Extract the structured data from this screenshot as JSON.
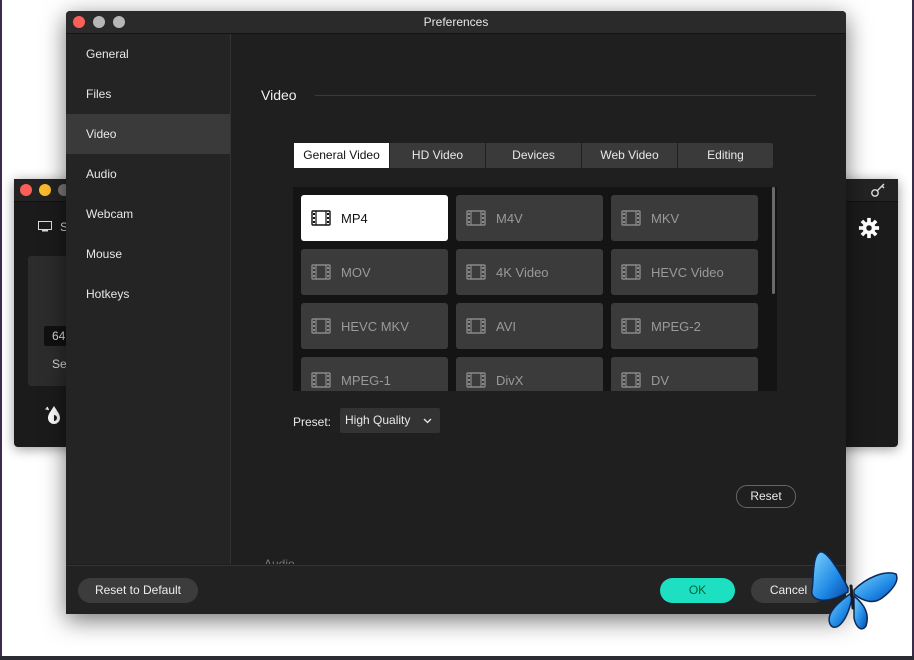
{
  "background_window": {
    "label_fragment": "S",
    "chip1": "64",
    "chip2": "Se"
  },
  "window": {
    "title": "Preferences"
  },
  "sidebar": {
    "items": [
      {
        "label": "General"
      },
      {
        "label": "Files"
      },
      {
        "label": "Video",
        "active": true
      },
      {
        "label": "Audio"
      },
      {
        "label": "Webcam"
      },
      {
        "label": "Mouse"
      },
      {
        "label": "Hotkeys"
      }
    ]
  },
  "section": {
    "title": "Video",
    "next_section_partial": "Audio"
  },
  "tabs": [
    {
      "label": "General Video",
      "active": true
    },
    {
      "label": "HD Video"
    },
    {
      "label": "Devices"
    },
    {
      "label": "Web Video"
    },
    {
      "label": "Editing"
    }
  ],
  "formats": [
    {
      "label": "MP4",
      "selected": true
    },
    {
      "label": "M4V"
    },
    {
      "label": "MKV"
    },
    {
      "label": "MOV"
    },
    {
      "label": "4K Video"
    },
    {
      "label": "HEVC Video"
    },
    {
      "label": "HEVC MKV"
    },
    {
      "label": "AVI"
    },
    {
      "label": "MPEG-2"
    },
    {
      "label": "MPEG-1"
    },
    {
      "label": "DivX"
    },
    {
      "label": "DV"
    }
  ],
  "preset": {
    "label": "Preset:",
    "value": "High Quality"
  },
  "buttons": {
    "reset": "Reset",
    "reset_default": "Reset to Default",
    "ok": "OK",
    "cancel": "Cancel"
  },
  "colors": {
    "accent_ok": "#1de0c2",
    "background": "#1f1f1f",
    "sidebar_active": "#3a3a3a"
  },
  "icons": [
    "film-icon",
    "chevron-down-icon",
    "gear-icon",
    "key-icon",
    "monitor-icon",
    "drop-icon",
    "butterfly-icon"
  ]
}
